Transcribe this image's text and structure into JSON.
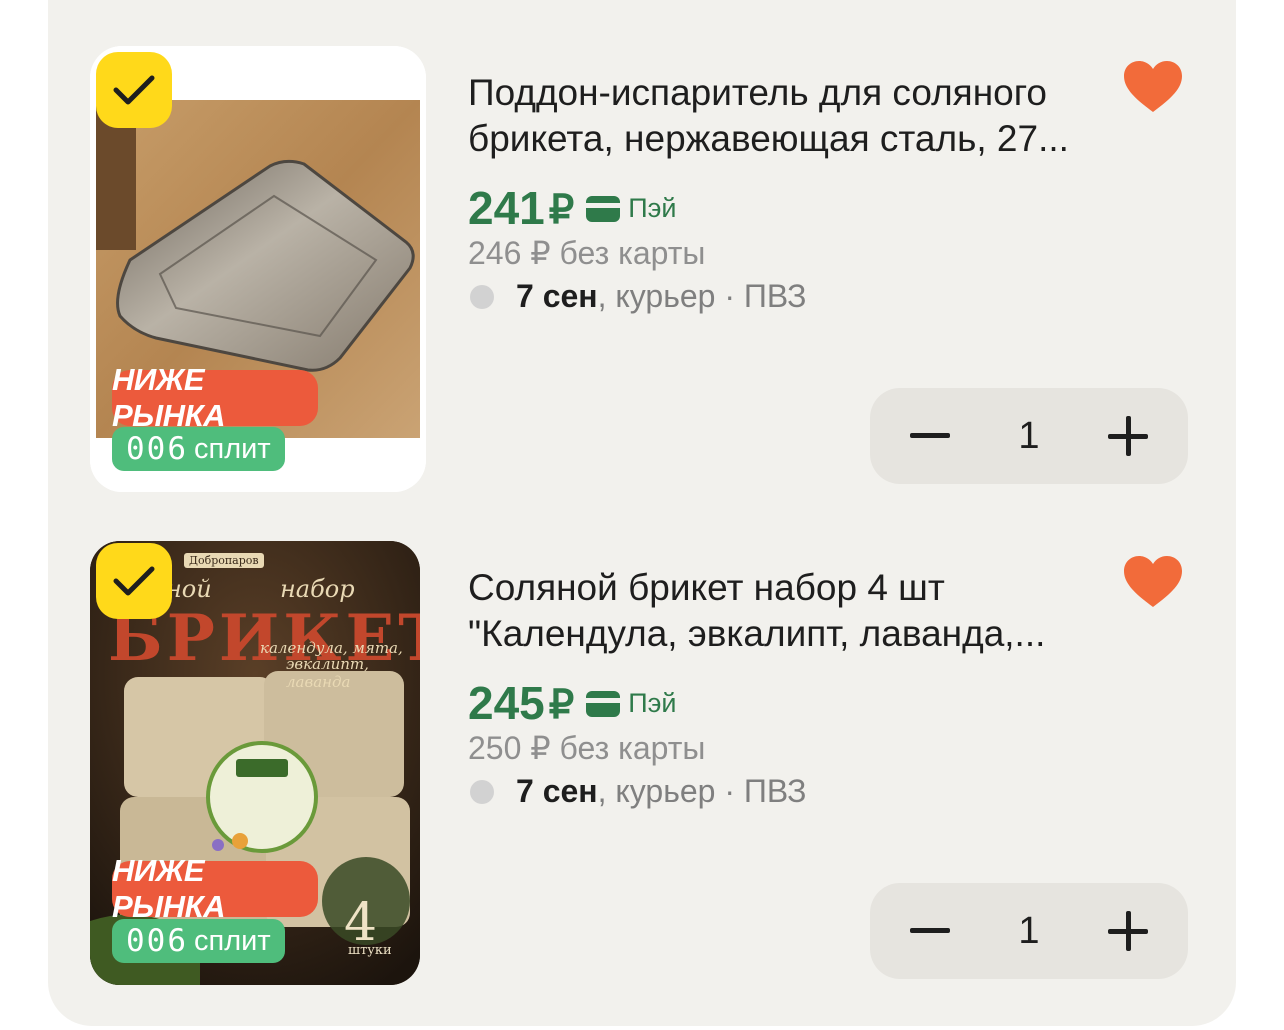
{
  "products": [
    {
      "title": "Поддон-испаритель для соляного брикета, нержавеющая сталь, 27...",
      "badge_market": "НИЖЕ РЫНКА",
      "split_number": "006",
      "split_label": "сплит",
      "price": "241",
      "currency": "₽",
      "pay_label": "Пэй",
      "old_price": "246 ₽ без карты",
      "delivery_date": "7 сен",
      "delivery_options": ", курьер · ПВЗ",
      "quantity": "1",
      "favorite": true,
      "selected": true
    },
    {
      "title": "Соляной брикет набор 4 шт \"Календула, эвкалипт, лаванда,...",
      "badge_market": "НИЖЕ РЫНКА",
      "split_number": "006",
      "split_label": "сплит",
      "price": "245",
      "currency": "₽",
      "pay_label": "Пэй",
      "old_price": "250 ₽ без карты",
      "delivery_date": "7 сен",
      "delivery_options": ", курьер · ПВЗ",
      "quantity": "1",
      "favorite": true,
      "selected": true,
      "image_text": {
        "brand": "Добропаров",
        "word_top_left": "ной",
        "word_top_right": "набор",
        "big": "БРИКЕТ",
        "herbs_line1": "календула, мята,",
        "herbs_line2": "эвкалипт, лаванда",
        "count": "4",
        "count_unit": "штуки"
      }
    }
  ],
  "colors": {
    "panel": "#f2f1ed",
    "price_green": "#2f7a4a",
    "checkbox_yellow": "#ffd91a",
    "badge_orange": "#ec5a3c",
    "badge_green": "#4fbd7c",
    "heart": "#f26b3a"
  },
  "icons": [
    "check-icon",
    "heart-icon",
    "card-icon",
    "minus-icon",
    "plus-icon"
  ]
}
